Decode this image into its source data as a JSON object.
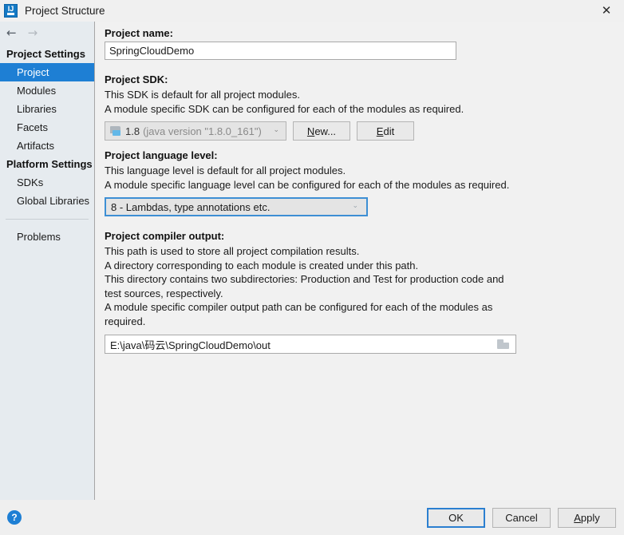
{
  "window": {
    "title": "Project Structure",
    "app_icon": "intellij-idea-icon",
    "close_icon": "✕"
  },
  "sidebar": {
    "back_icon": "←",
    "forward_icon": "→",
    "groups": [
      {
        "header": "Project Settings",
        "items": [
          {
            "label": "Project",
            "selected": true
          },
          {
            "label": "Modules",
            "selected": false
          },
          {
            "label": "Libraries",
            "selected": false
          },
          {
            "label": "Facets",
            "selected": false
          },
          {
            "label": "Artifacts",
            "selected": false
          }
        ]
      },
      {
        "header": "Platform Settings",
        "items": [
          {
            "label": "SDKs",
            "selected": false
          },
          {
            "label": "Global Libraries",
            "selected": false
          }
        ]
      }
    ],
    "problems_label": "Problems"
  },
  "main": {
    "project_name": {
      "label": "Project name:",
      "value": "SpringCloudDemo",
      "placeholder": ""
    },
    "project_sdk": {
      "label": "Project SDK:",
      "desc_line1": "This SDK is default for all project modules.",
      "desc_line2": "A module specific SDK can be configured for each of the modules as required.",
      "selected_version": "1.8",
      "selected_detail": "(java version \"1.8.0_161\")",
      "dropdown_icon": "⌄",
      "new_button": "New...",
      "new_button_mnemonic": "N",
      "edit_button": "Edit",
      "edit_button_mnemonic": "E"
    },
    "language_level": {
      "label": "Project language level:",
      "desc_line1": "This language level is default for all project modules.",
      "desc_line2": "A module specific language level can be configured for each of the modules as required.",
      "selected": "8 - Lambdas, type annotations etc.",
      "dropdown_icon": "⌄"
    },
    "compiler_output": {
      "label": "Project compiler output:",
      "desc_line1": "This path is used to store all project compilation results.",
      "desc_line2": "A directory corresponding to each module is created under this path.",
      "desc_line3": "This directory contains two subdirectories: Production and Test for production code and test sources, respectively.",
      "desc_line4": "A module specific compiler output path can be configured for each of the modules as required.",
      "value": "E:\\java\\码云\\SpringCloudDemo\\out",
      "browse_icon": "folder-icon"
    }
  },
  "footer": {
    "help_icon": "?",
    "ok_label": "OK",
    "cancel_label": "Cancel",
    "apply_label": "Apply",
    "apply_mnemonic": "A"
  },
  "colors": {
    "accent": "#1e7fd4",
    "sidebar_bg": "#e6ebef",
    "content_bg": "#f1f1f1"
  }
}
